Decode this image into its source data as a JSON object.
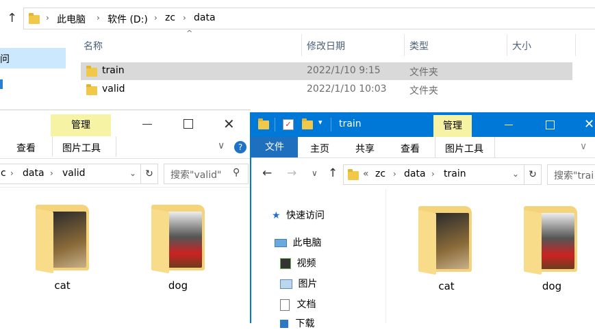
{
  "top": {
    "breadcrumb": [
      "此电脑",
      "软件 (D:)",
      "zc",
      "data"
    ],
    "columns": [
      "名称",
      "修改日期",
      "类型",
      "大小"
    ],
    "rows": [
      {
        "name": "train",
        "date": "2022/1/10 9:15",
        "type": "文件夹"
      },
      {
        "name": "valid",
        "date": "2022/1/10 10:03",
        "type": "文件夹"
      }
    ],
    "sidebar_partial": "问"
  },
  "left": {
    "manage_label": "管理",
    "tabs": [
      "查看",
      "图片工具"
    ],
    "breadcrumb": [
      "c",
      "data",
      "valid"
    ],
    "search_placeholder": "搜索\"valid\"",
    "items": [
      {
        "label": "cat"
      },
      {
        "label": "dog"
      }
    ]
  },
  "right": {
    "title": "train",
    "manage_label": "管理",
    "tabs": [
      "文件",
      "主页",
      "共享",
      "查看",
      "图片工具"
    ],
    "breadcrumb": [
      "«",
      "zc",
      "data",
      "train"
    ],
    "search_placeholder": "搜索\"trai",
    "nav": [
      "快速访问",
      "此电脑",
      "视频",
      "图片",
      "文档",
      "下载"
    ],
    "items": [
      {
        "label": "cat"
      },
      {
        "label": "dog"
      }
    ]
  },
  "colors": {
    "accent": "#0078d7",
    "selected_row": "#d9d9d9",
    "manage_bg": "#f7f3a5"
  }
}
